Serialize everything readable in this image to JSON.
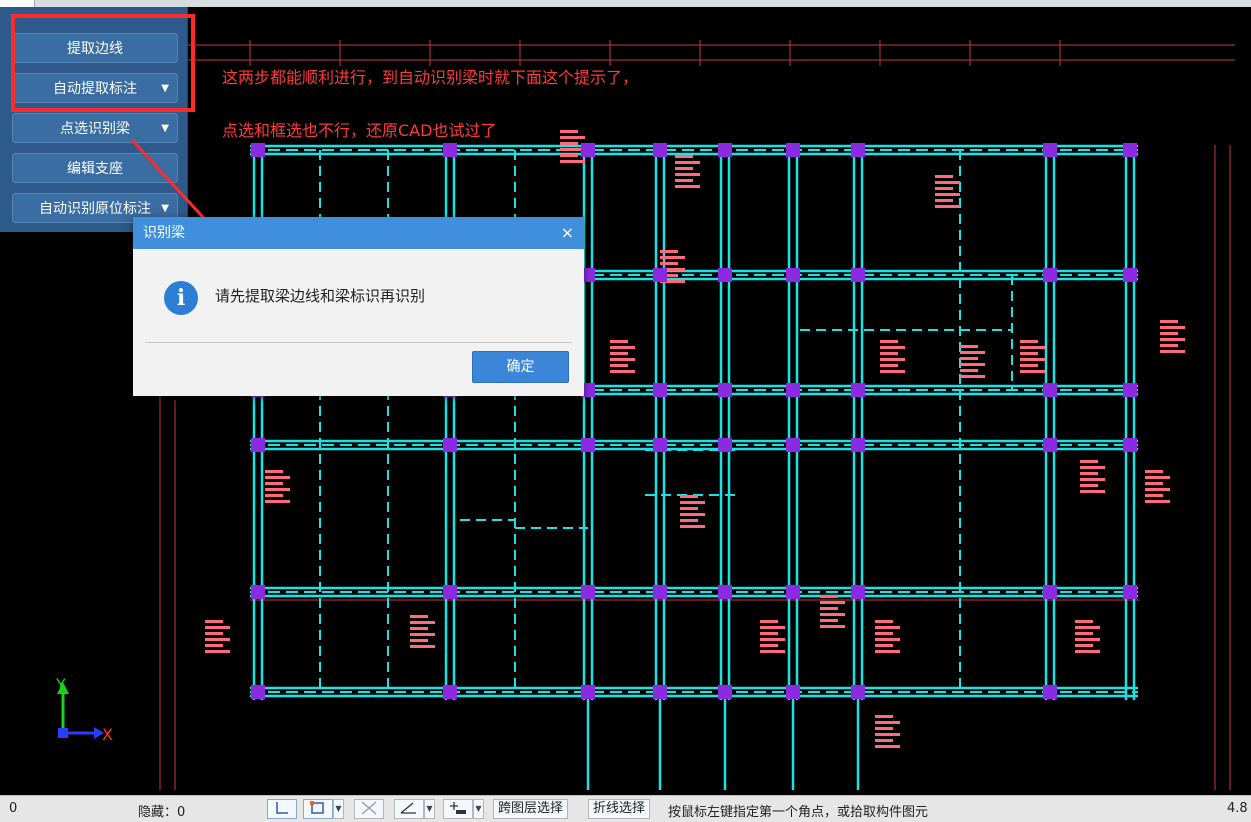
{
  "panel": {
    "buttons": [
      {
        "label": "提取边线",
        "dropdown": false
      },
      {
        "label": "自动提取标注",
        "dropdown": true
      },
      {
        "label": "点选识别梁",
        "dropdown": true
      },
      {
        "label": "编辑支座",
        "dropdown": false
      },
      {
        "label": "自动识别原位标注",
        "dropdown": true
      }
    ]
  },
  "annotations": {
    "line1": "这两步都能顺利进行，到自动识别梁时就下面这个提示了，",
    "line2": "点选和框选也不行，还原CAD也试过了",
    "color": "#ff3b3b"
  },
  "dialog": {
    "title": "识别梁",
    "close": "×",
    "icon": "i",
    "message": "请先提取梁边线和梁标识再识别",
    "ok_label": "确定"
  },
  "axis": {
    "y": "Y",
    "x": "X"
  },
  "statusbar": {
    "left_value": "0",
    "hidden_label": "隐藏：0",
    "layer_select": "跨图层选择",
    "polyline_select": "折线选择",
    "hint": "按鼠标左键指定第一个角点，或拾取构件图元",
    "right_value": "4.8"
  },
  "colors": {
    "beam": "#19e3e3",
    "column": "#8a2be2",
    "label": "#ff6b7a",
    "dim": "#c8393f",
    "panel": "#2d5a8a",
    "dialog_title": "#3f8fdc"
  },
  "icons": [
    "info-icon",
    "close-icon",
    "chevron-down-icon",
    "ortho-icon",
    "snap-box-icon",
    "cross-icon",
    "angle-icon",
    "insert-icon",
    "axis-icon"
  ]
}
